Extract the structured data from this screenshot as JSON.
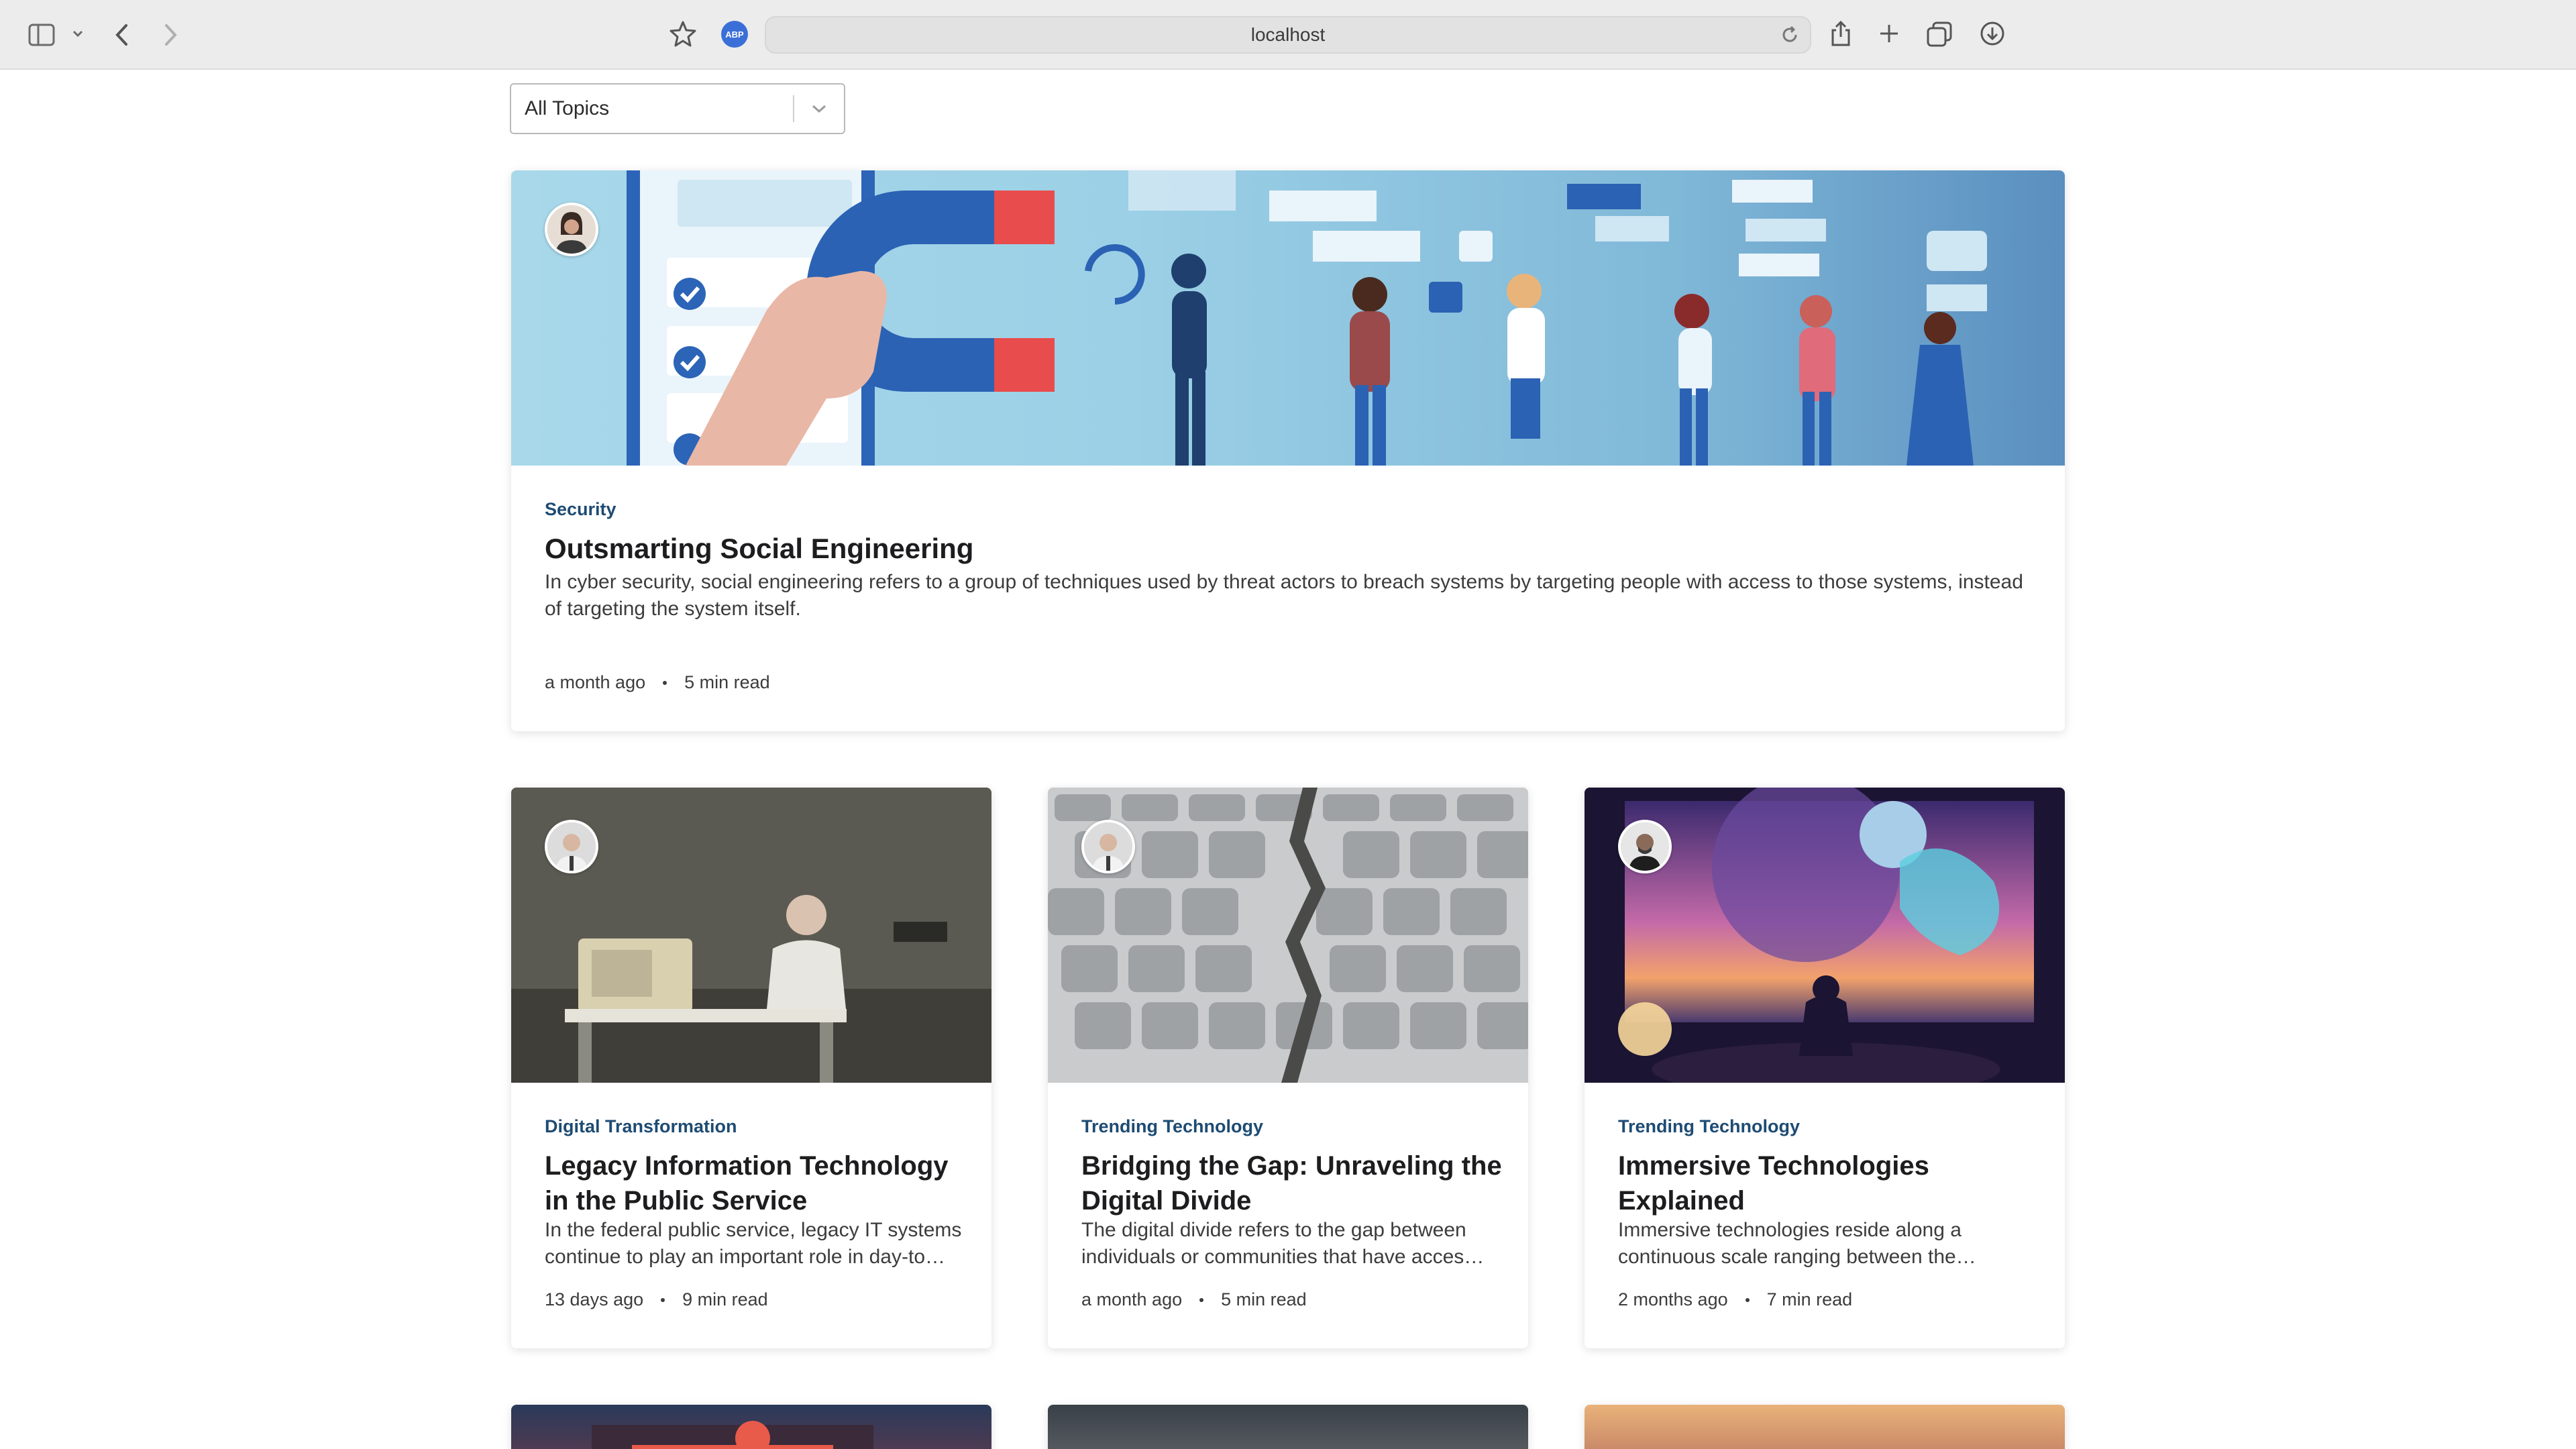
{
  "browser": {
    "url": "localhost",
    "extension_badge": "ABP"
  },
  "filter": {
    "selected": "All Topics"
  },
  "featured": {
    "tag": "Security",
    "title": "Outsmarting Social Engineering",
    "excerpt": "In cyber security, social engineering refers to a group of techniques used by threat actors to breach systems by targeting people with access to those systems, instead of targeting the system itself.",
    "date": "a month ago",
    "read": "5 min read"
  },
  "articles": [
    {
      "tag": "Digital Transformation",
      "title": "Legacy Information Technology in the Public Service",
      "excerpt": "In the federal public service, legacy IT systems continue to play an important role in day-to…",
      "date": "13 days ago",
      "read": "9 min read"
    },
    {
      "tag": "Trending Technology",
      "title": "Bridging the Gap: Unraveling the Digital Divide",
      "excerpt": "The digital divide refers to the gap between individuals or communities that have acces…",
      "date": "a month ago",
      "read": "5 min read"
    },
    {
      "tag": "Trending Technology",
      "title": "Immersive Technologies Explained",
      "excerpt": "Immersive technologies reside along a continuous scale ranging between the…",
      "date": "2 months ago",
      "read": "7 min read"
    }
  ],
  "colors": {
    "tag": "#1e4b73",
    "featured_bg": "#8ec3df",
    "magnet": "#2b62b4"
  }
}
